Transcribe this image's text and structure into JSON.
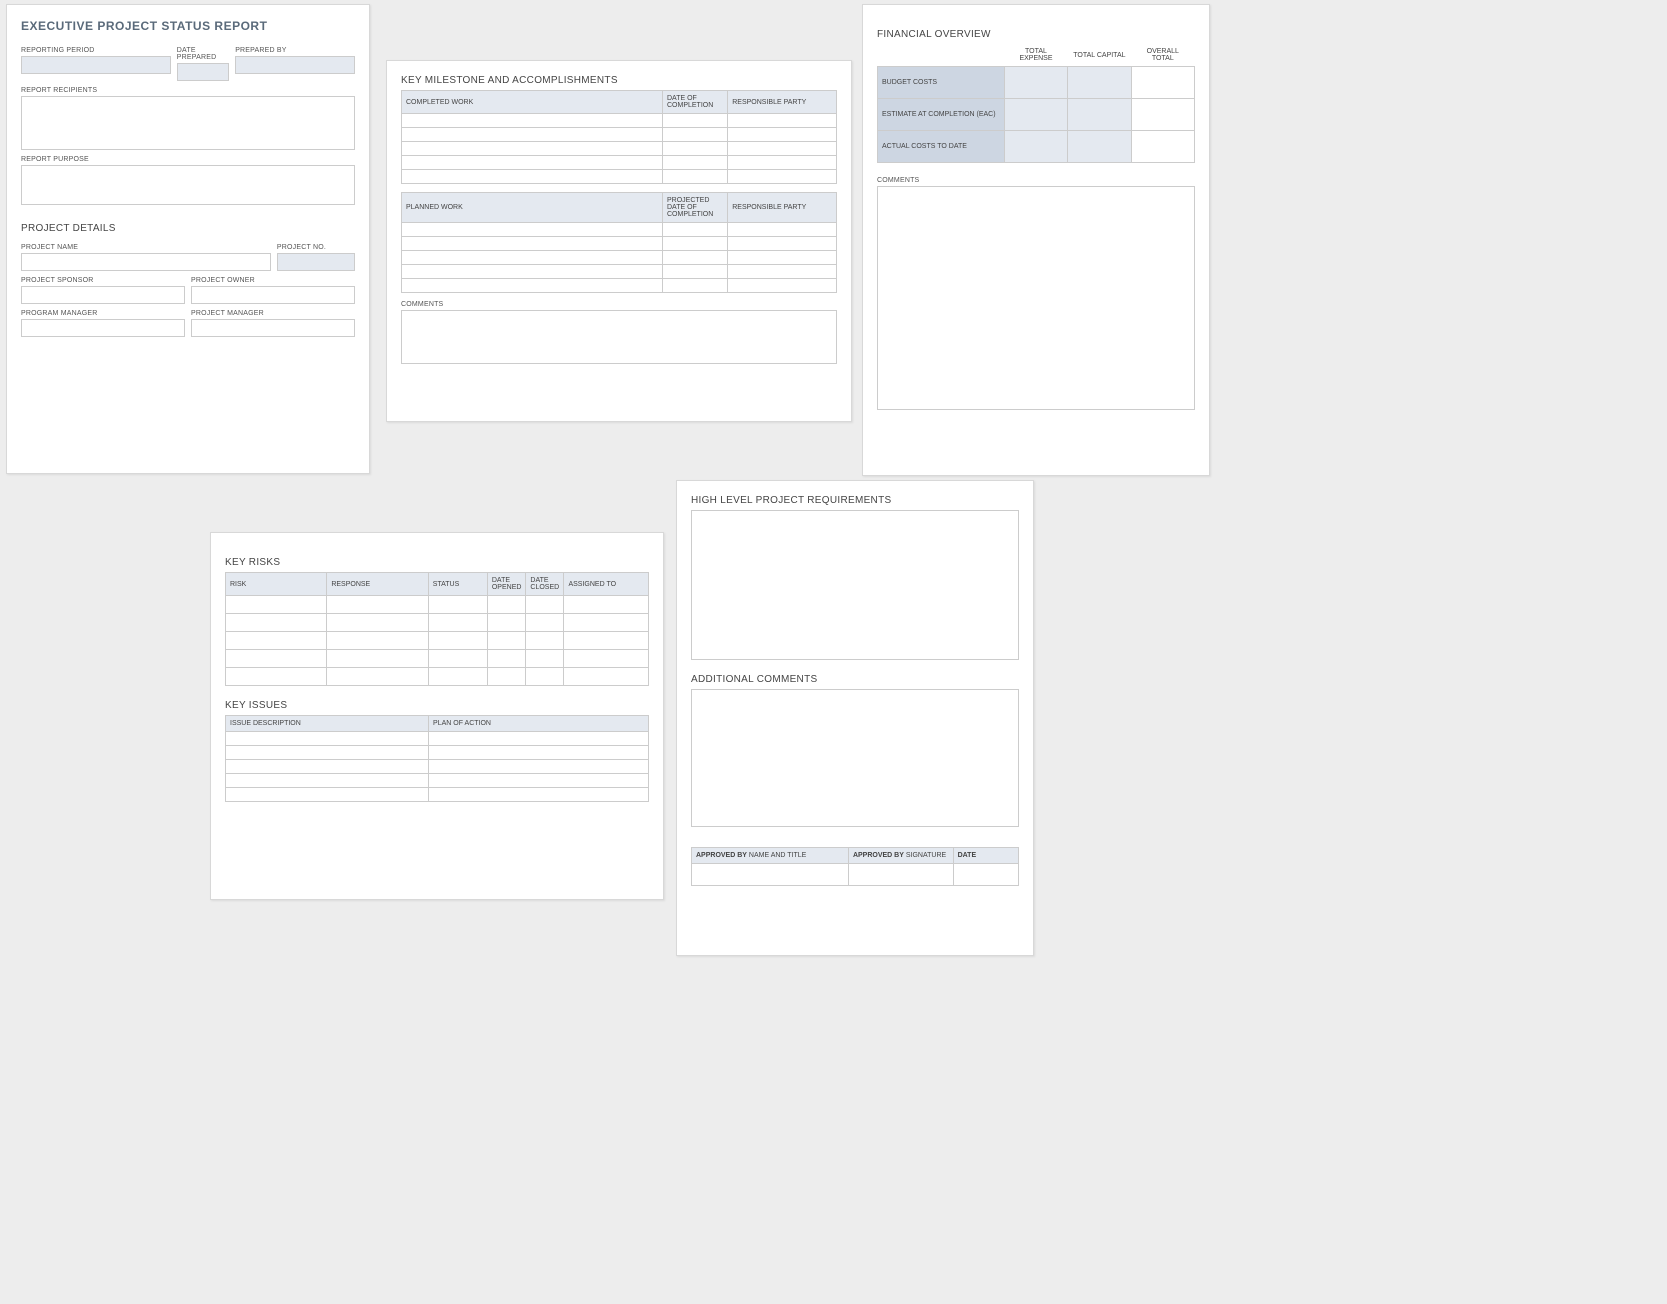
{
  "header": {
    "title": "EXECUTIVE PROJECT STATUS REPORT",
    "reporting_period": "REPORTING PERIOD",
    "date_prepared": "DATE PREPARED",
    "prepared_by": "PREPARED BY",
    "report_recipients": "REPORT RECIPIENTS",
    "report_purpose": "REPORT PURPOSE"
  },
  "project_details": {
    "heading": "PROJECT DETAILS",
    "project_name": "PROJECT NAME",
    "project_no": "PROJECT NO.",
    "project_sponsor": "PROJECT SPONSOR",
    "project_owner": "PROJECT OWNER",
    "program_manager": "PROGRAM MANAGER",
    "project_manager": "PROJECT MANAGER"
  },
  "milestones": {
    "heading": "KEY MILESTONE AND ACCOMPLISHMENTS",
    "completed_work": "COMPLETED WORK",
    "date_of_completion": "DATE OF COMPLETION",
    "responsible_party": "RESPONSIBLE PARTY",
    "planned_work": "PLANNED WORK",
    "projected_date_of_completion": "PROJECTED DATE OF COMPLETION",
    "comments": "COMMENTS"
  },
  "financial": {
    "heading": "FINANCIAL OVERVIEW",
    "total_expense": "TOTAL EXPENSE",
    "total_capital": "TOTAL CAPITAL",
    "overall_total": "OVERALL TOTAL",
    "budget_costs": "BUDGET COSTS",
    "eac": "ESTIMATE AT COMPLETION (EAC)",
    "actual": "ACTUAL COSTS TO DATE",
    "comments": "COMMENTS"
  },
  "risks": {
    "heading": "KEY RISKS",
    "risk": "RISK",
    "response": "RESPONSE",
    "status": "STATUS",
    "date_opened": "DATE OPENED",
    "date_closed": "DATE CLOSED",
    "assigned_to": "ASSIGNED TO"
  },
  "issues": {
    "heading": "KEY ISSUES",
    "issue_description": "ISSUE DESCRIPTION",
    "plan_of_action": "PLAN OF ACTION"
  },
  "requirements": {
    "heading": "HIGH LEVEL PROJECT REQUIREMENTS",
    "additional_comments": "ADDITIONAL COMMENTS"
  },
  "approval": {
    "approved_by_bold": "APPROVED BY",
    "name_and_title": " NAME AND TITLE",
    "signature": " SIGNATURE",
    "date": "DATE"
  }
}
